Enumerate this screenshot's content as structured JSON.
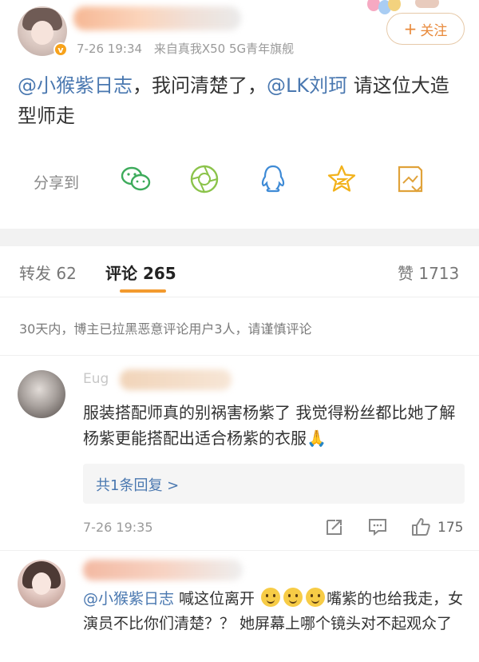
{
  "post": {
    "author_name": "",
    "time": "7-26 19:34",
    "source": "来自真我X50 5G青年旗舰",
    "follow_label": "关注",
    "mention1": "@小猴紫日志",
    "text_part1": "，我问清楚了，",
    "mention2": "@LK刘珂",
    "text_part2": " 请这位大造型师走"
  },
  "share": {
    "label": "分享到",
    "icons": [
      "wechat-icon",
      "moments-icon",
      "qq-icon",
      "qzone-icon",
      "save-image-icon"
    ]
  },
  "tabs": {
    "repost": "转发 62",
    "comment": "评论 265",
    "like": "赞 1713"
  },
  "notice": "30天内，博主已拉黑恶意评论用户3人，请谨慎评论",
  "comments": [
    {
      "name_visible": "Eug",
      "text": "服装搭配师真的别祸害杨紫了 我觉得粉丝都比她了解杨紫更能搭配出适合杨紫的衣服🙏",
      "reply_link": "共1条回复 >",
      "time": "7-26 19:35",
      "likes": "175"
    },
    {
      "mention": "@小猴紫日志",
      "text_a": " 喊这位离开",
      "text_b": "嘴紫的也给我走，女演员不比你们清楚？？ 她屏幕上哪个镜头对不起观众了"
    }
  ],
  "colors": {
    "accent": "#f39a2e",
    "link": "#4a78b0",
    "follow": "#e8893a"
  }
}
